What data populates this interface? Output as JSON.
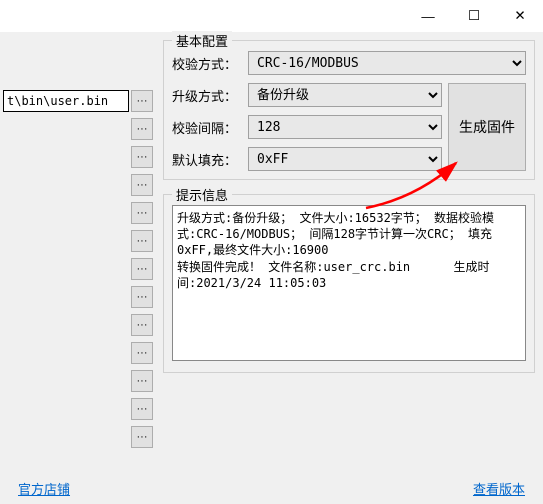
{
  "titlebar": {
    "minimize": "—",
    "maximize": "☐",
    "close": "✕"
  },
  "left": {
    "file_path": "t\\bin\\user.bin",
    "browse": "···",
    "more": "···"
  },
  "config": {
    "group_title": "基本配置",
    "check_mode_label": "校验方式：",
    "check_mode_value": "CRC-16/MODBUS",
    "upgrade_mode_label": "升级方式：",
    "upgrade_mode_value": "备份升级",
    "check_interval_label": "校验间隔：",
    "check_interval_value": "128",
    "default_fill_label": "默认填充：",
    "default_fill_value": "0xFF",
    "generate_btn": "生成固件"
  },
  "log": {
    "group_title": "提示信息",
    "content": "升级方式:备份升级； 文件大小:16532字节； 数据校验模式:CRC-16/MODBUS； 间隔128字节计算一次CRC； 填充0xFF,最终文件大小:16900\n转换固件完成！ 文件名称:user_crc.bin      生成时间:2021/3/24 11:05:03"
  },
  "footer": {
    "shop_link": "官方店铺",
    "version_link": "查看版本"
  }
}
